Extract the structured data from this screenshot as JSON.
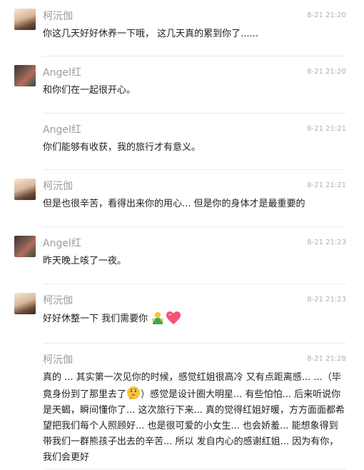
{
  "messages": [
    {
      "name": "柯沅伽",
      "time": "8-21 21:20",
      "text": "你这几天好好休养一下哦， 这几天真的累到你了......"
    },
    {
      "name": "Angel红",
      "time": "8-21 21:20",
      "text": "和你们在一起很开心。"
    },
    {
      "name": "Angel红",
      "time": "8-21 21:21",
      "text": "你们能够有收获，我的旅行才有意义。"
    },
    {
      "name": "柯沅伽",
      "time": "8-21 21:21",
      "text": "但是也很辛苦，看得出来你的用心... 但是你的身体才是最重要的"
    },
    {
      "name": "Angel红",
      "time": "8-21 21:23",
      "text": "昨天晚上咳了一夜。"
    },
    {
      "name": "柯沅伽",
      "time": "8-21 21:23",
      "text": "好好休整一下 我们需要你"
    },
    {
      "name": "柯沅伽",
      "time": "8-21 21:28",
      "text_part1": "真的 ... 其实第一次见你的时候，感觉红姐很高冷 又有点距离感... ...（毕竟身份到了那里去了",
      "text_part2": "）感觉是设计圈大明星... 有些怕怕... 后来听说你是天蝎，瞬间懂你了... 这次旅行下来... 真的觉得红姐好暖，方方面面都希望把我们每个人照顾好... 也是很可爱的小女生... 也会娇羞... 能想象得到带我们一群熊孩子出去的辛苦... 所以 发自内心的感谢红姐... 因为有你，我们会更好"
    }
  ],
  "icons": {
    "hug": "hugging-person-emoji",
    "heart": "pink-heart-emoji",
    "think": "thinking-face-emoji"
  }
}
